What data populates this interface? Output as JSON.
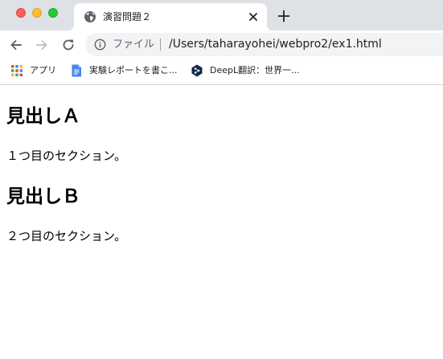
{
  "browser": {
    "tab": {
      "title": "演習問題２",
      "favicon": "globe-icon"
    },
    "new_tab_icon": "plus-icon",
    "omnibox": {
      "scheme_label": "ファイル",
      "url": "/Users/taharayohei/webpro2/ex1.html"
    },
    "bookmarks": [
      {
        "label": "アプリ",
        "icon": "apps-grid-icon"
      },
      {
        "label": "実験レポートを書こ...",
        "icon": "google-docs-icon"
      },
      {
        "label": "DeepL翻訳：世界一...",
        "icon": "deepl-icon"
      }
    ]
  },
  "page": {
    "sections": [
      {
        "heading": "見出しＡ",
        "text": "１つ目のセクション。"
      },
      {
        "heading": "見出しＢ",
        "text": "２つ目のセクション。"
      }
    ]
  },
  "colors": {
    "tabstrip_bg": "#dee1e6",
    "omnibox_bg": "#f1f3f4",
    "traffic_close": "#ff5f57",
    "traffic_min": "#febc2e",
    "traffic_max": "#28c840"
  }
}
